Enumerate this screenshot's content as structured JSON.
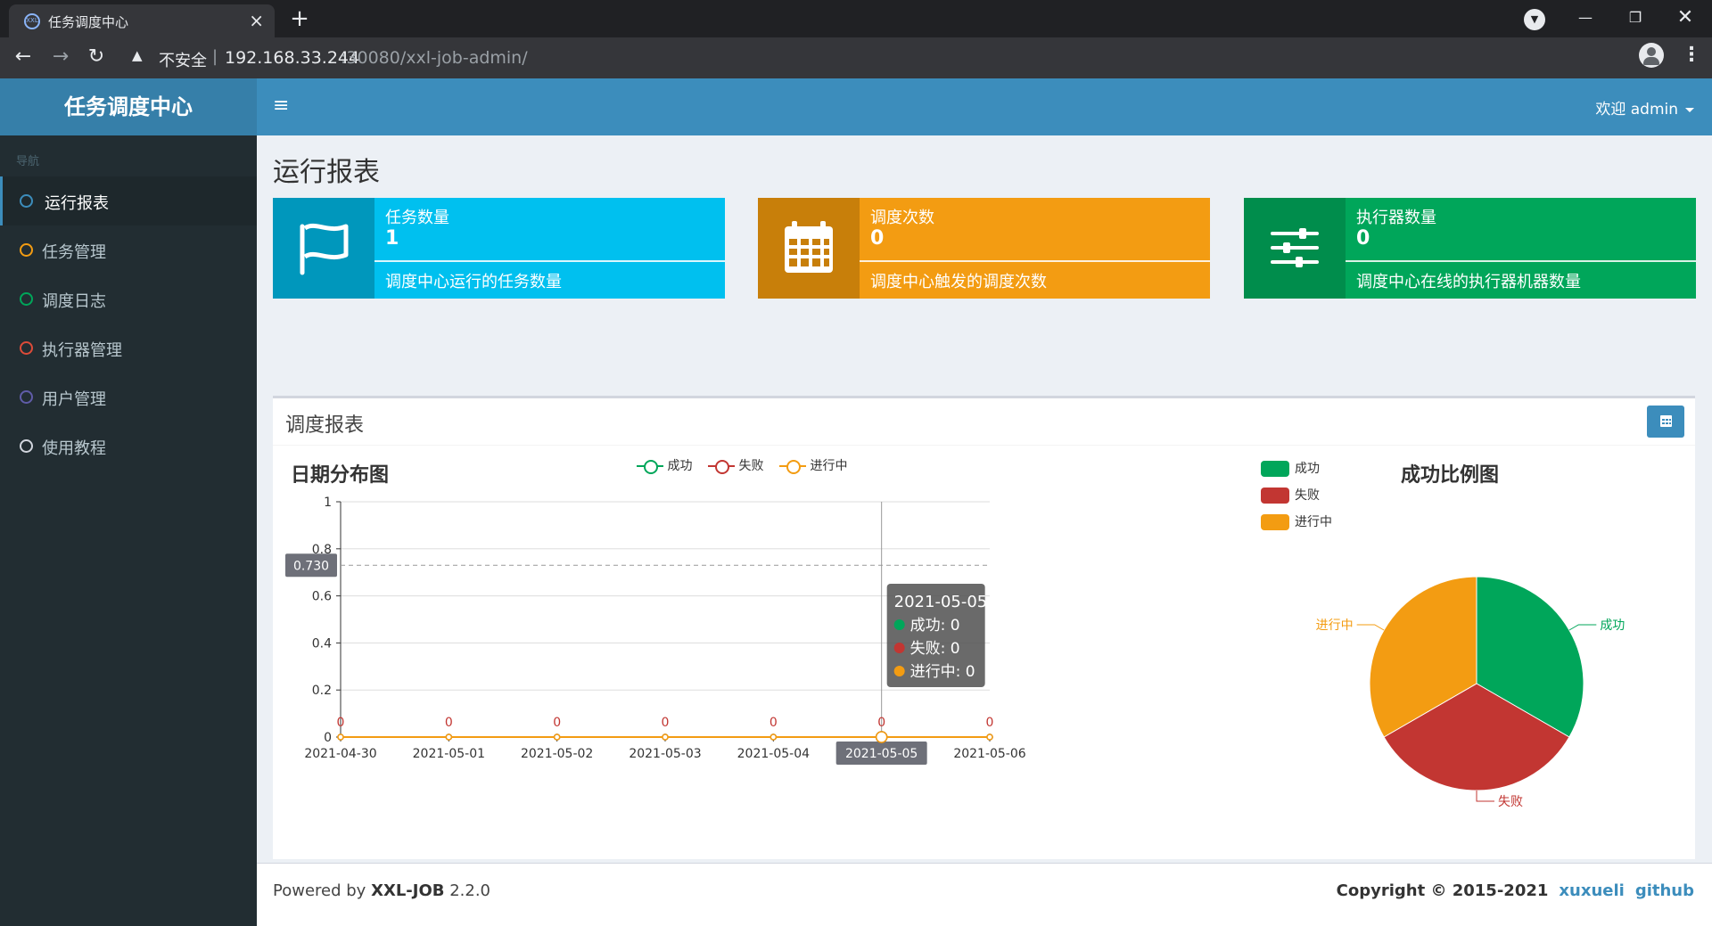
{
  "browser": {
    "tab_title": "任务调度中心",
    "tab_favicon_text": "XXL",
    "insecure_label": "不安全",
    "url_host": "192.168.33.244",
    "url_rest": ":30080/xxl-job-admin/"
  },
  "app": {
    "brand": "任务调度中心",
    "welcome": "欢迎 admin"
  },
  "sidebar": {
    "header": "导航",
    "items": [
      {
        "label": "运行报表",
        "color": "#3c8dbc"
      },
      {
        "label": "任务管理",
        "color": "#f39c12"
      },
      {
        "label": "调度日志",
        "color": "#00a65a"
      },
      {
        "label": "执行器管理",
        "color": "#dd4b39"
      },
      {
        "label": "用户管理",
        "color": "#605ca8"
      },
      {
        "label": "使用教程",
        "color": "#d2d6de"
      }
    ]
  },
  "page": {
    "title": "运行报表"
  },
  "stats": [
    {
      "title": "任务数量",
      "value": "1",
      "desc": "调度中心运行的任务数量",
      "color": "#00c0ef",
      "icon_bg": "#0097bc",
      "icon": "flag-icon"
    },
    {
      "title": "调度次数",
      "value": "0",
      "desc": "调度中心触发的调度次数",
      "color": "#f39c12",
      "icon_bg": "#c87f0a",
      "icon": "calendar-icon"
    },
    {
      "title": "执行器数量",
      "value": "0",
      "desc": "调度中心在线的执行器机器数量",
      "color": "#00a65a",
      "icon_bg": "#008d4c",
      "icon": "sliders-icon"
    }
  ],
  "report": {
    "box_title": "调度报表",
    "line_chart_title": "日期分布图",
    "pie_chart_title": "成功比例图",
    "legend": [
      {
        "name": "成功",
        "color": "#00a65a"
      },
      {
        "name": "失败",
        "color": "#c23632"
      },
      {
        "name": "进行中",
        "color": "#f39c12"
      }
    ],
    "tooltip": {
      "date": "2021-05-05",
      "lines": [
        "成功: 0",
        "失败: 0",
        "进行中: 0"
      ]
    },
    "crosshair_y_label": "0.730"
  },
  "chart_data": [
    {
      "type": "line",
      "title": "日期分布图",
      "x": [
        "2021-04-30",
        "2021-05-01",
        "2021-05-02",
        "2021-05-03",
        "2021-05-04",
        "2021-05-05",
        "2021-05-06"
      ],
      "ylim": [
        0,
        1
      ],
      "yticks": [
        "0",
        "0.2",
        "0.4",
        "0.6",
        "0.8",
        "1"
      ],
      "series": [
        {
          "name": "成功",
          "values": [
            0,
            0,
            0,
            0,
            0,
            0,
            0
          ],
          "color": "#00a65a"
        },
        {
          "name": "失败",
          "values": [
            0,
            0,
            0,
            0,
            0,
            0,
            0
          ],
          "color": "#c23632"
        },
        {
          "name": "进行中",
          "values": [
            0,
            0,
            0,
            0,
            0,
            0,
            0
          ],
          "color": "#f39c12"
        }
      ],
      "data_labels": [
        "0",
        "0",
        "0",
        "0",
        "0",
        "0",
        "0"
      ],
      "highlight_x": "2021-05-05",
      "grid": true,
      "legend": "top-center"
    },
    {
      "type": "pie",
      "title": "成功比例图",
      "labels": [
        "成功",
        "失败",
        "进行中"
      ],
      "values": [
        1,
        1,
        1
      ],
      "colors": [
        "#00a65a",
        "#c23632",
        "#f39c12"
      ],
      "legend": "top-left"
    }
  ],
  "footer": {
    "powered_prefix": "Powered by ",
    "product": "XXL-JOB",
    "version": " 2.2.0",
    "copyright": "Copyright © 2015-2021",
    "link1": "xuxueli",
    "link2": "github"
  }
}
